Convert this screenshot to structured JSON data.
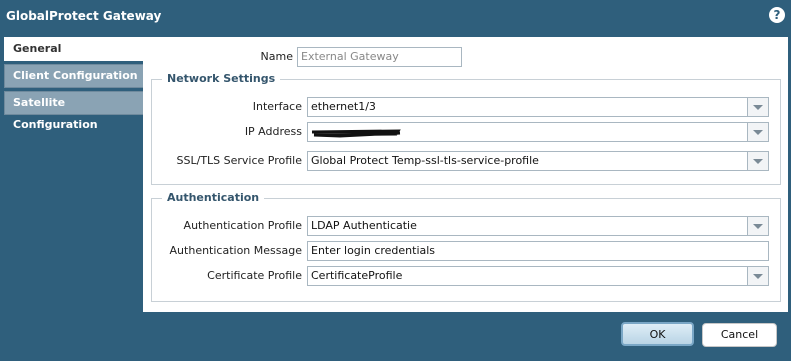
{
  "window": {
    "title": "GlobalProtect Gateway",
    "help_glyph": "?"
  },
  "tabs": [
    {
      "label": "General",
      "active": true
    },
    {
      "label": "Client Configuration",
      "active": false
    },
    {
      "label": "Satellite Configuration",
      "active": false
    }
  ],
  "general": {
    "name": {
      "label": "Name",
      "value": "External Gateway"
    },
    "network": {
      "legend": "Network Settings",
      "interface": {
        "label": "Interface",
        "value": "ethernet1/3"
      },
      "ip_address": {
        "label": "IP Address",
        "value": ""
      },
      "ssl_profile": {
        "label": "SSL/TLS Service Profile",
        "value": "Global Protect Temp-ssl-tls-service-profile"
      }
    },
    "auth": {
      "legend": "Authentication",
      "profile": {
        "label": "Authentication Profile",
        "value": "LDAP Authenticatie"
      },
      "message": {
        "label": "Authentication Message",
        "value": "Enter login credentials"
      },
      "certificate": {
        "label": "Certificate Profile",
        "value": "CertificateProfile"
      }
    }
  },
  "buttons": {
    "ok": "OK",
    "cancel": "Cancel"
  },
  "colors": {
    "window_bg": "#2f5f7c",
    "legend_text": "#35566d",
    "tab_inactive": "#8aa3b4"
  }
}
